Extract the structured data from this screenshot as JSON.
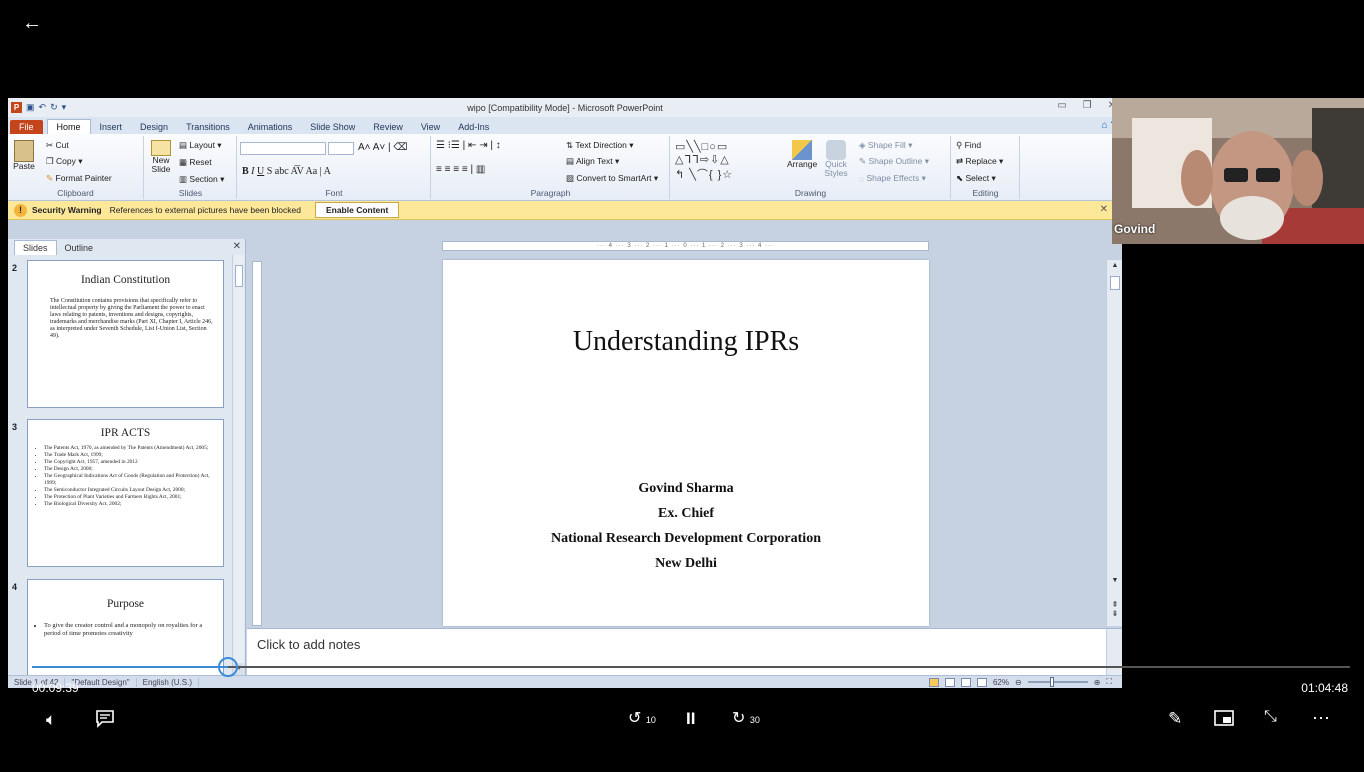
{
  "player": {
    "elapsed": "00:09:39",
    "duration": "01:04:48",
    "progress_fraction": 0.149,
    "skip_back_seconds": "10",
    "skip_forward_seconds": "30"
  },
  "powerpoint": {
    "window_title": "wipo [Compatibility Mode]  -  Microsoft PowerPoint",
    "tabs": [
      "File",
      "Home",
      "Insert",
      "Design",
      "Transitions",
      "Animations",
      "Slide Show",
      "Review",
      "View",
      "Add-Ins"
    ],
    "ribbon": {
      "clipboard": {
        "paste": "Paste",
        "cut": "Cut",
        "copy": "Copy",
        "format_painter": "Format Painter",
        "label": "Clipboard"
      },
      "slides": {
        "new_slide": "New Slide",
        "layout": "Layout",
        "reset": "Reset",
        "section": "Section",
        "label": "Slides"
      },
      "font": {
        "label": "Font"
      },
      "paragraph": {
        "text_direction": "Text Direction",
        "align_text": "Align Text",
        "convert_smartart": "Convert to SmartArt",
        "label": "Paragraph"
      },
      "drawing": {
        "arrange": "Arrange",
        "quick_styles": "Quick Styles",
        "shape_fill": "Shape Fill",
        "shape_outline": "Shape Outline",
        "shape_effects": "Shape Effects",
        "label": "Drawing"
      },
      "editing": {
        "find": "Find",
        "replace": "Replace",
        "select": "Select",
        "label": "Editing"
      }
    },
    "security_bar": {
      "title": "Security Warning",
      "message": "References to external pictures have been blocked",
      "button": "Enable Content"
    },
    "left_pane": {
      "tabs": [
        "Slides",
        "Outline"
      ],
      "thumbnails": [
        {
          "number": "2",
          "title": "Indian Constitution",
          "body": "The Constitution contains provisions that specifically refer to intellectual property by giving the Parliament the power to enact laws relating to patents, inventions and designs, copyrights, trademarks and merchandise marks (Part XI, Chapter I, Article 246, as interpreted under Seventh Schedule, List I-Union List, Section 49)."
        },
        {
          "number": "3",
          "title": "IPR ACTS",
          "bullets": [
            "The Patents Act, 1970, as amended by The Patents (Amendment) Act, 2005;",
            "The Trade Mark Act, 1999;",
            "The Copyright Act, 1957,  amended in 2012",
            "The Design Act, 2000;",
            "The Geographical Indications Act of Goods (Regulation and Protection) Act, 1999;",
            "The Semiconductor Integrated Circuits Layout Design Act, 2000;",
            "The Protection of Plant Varieties and Farmers Rights Act, 2001;",
            "The Biological Diversity Act, 2002;"
          ]
        },
        {
          "number": "4",
          "title": "Purpose",
          "bullets": [
            "To give the creator control and a monopoly on royalties for a period of time promotes creativity"
          ]
        }
      ]
    },
    "current_slide": {
      "title": "Understanding IPRs",
      "lines": [
        "Govind Sharma",
        "Ex. Chief",
        "National Research Development Corporation",
        "New Delhi"
      ]
    },
    "notes_placeholder": "Click to add notes",
    "status": {
      "slide_info": "Slide 1 of 42",
      "theme": "\"Default Design\"",
      "language": "English (U.S.)",
      "zoom": "62%"
    }
  },
  "webcam": {
    "participant_name": "Govind"
  },
  "colors": {
    "accent": "#3a8cd8",
    "file_tab": "#c4441b",
    "security_bar": "#fde89a"
  }
}
